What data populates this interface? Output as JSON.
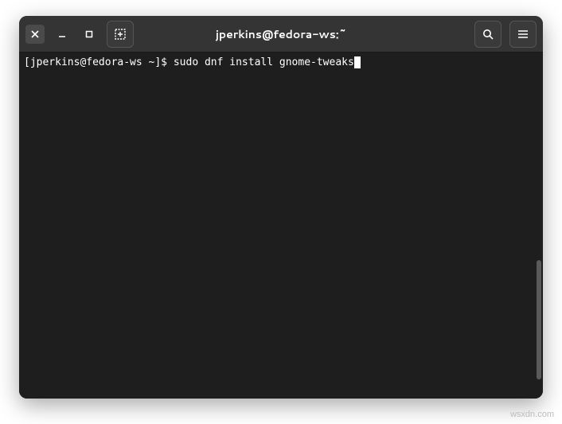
{
  "window": {
    "title": "jperkins@fedora-ws:~"
  },
  "terminal": {
    "prompt": "[jperkins@fedora-ws ~]$ ",
    "command": "sudo dnf install gnome-tweaks"
  },
  "icons": {
    "close": "close-icon",
    "minimize": "minimize-icon",
    "maximize": "maximize-icon",
    "newtab": "new-tab-icon",
    "search": "search-icon",
    "menu": "hamburger-menu-icon"
  },
  "watermark": "wsxdn.com"
}
